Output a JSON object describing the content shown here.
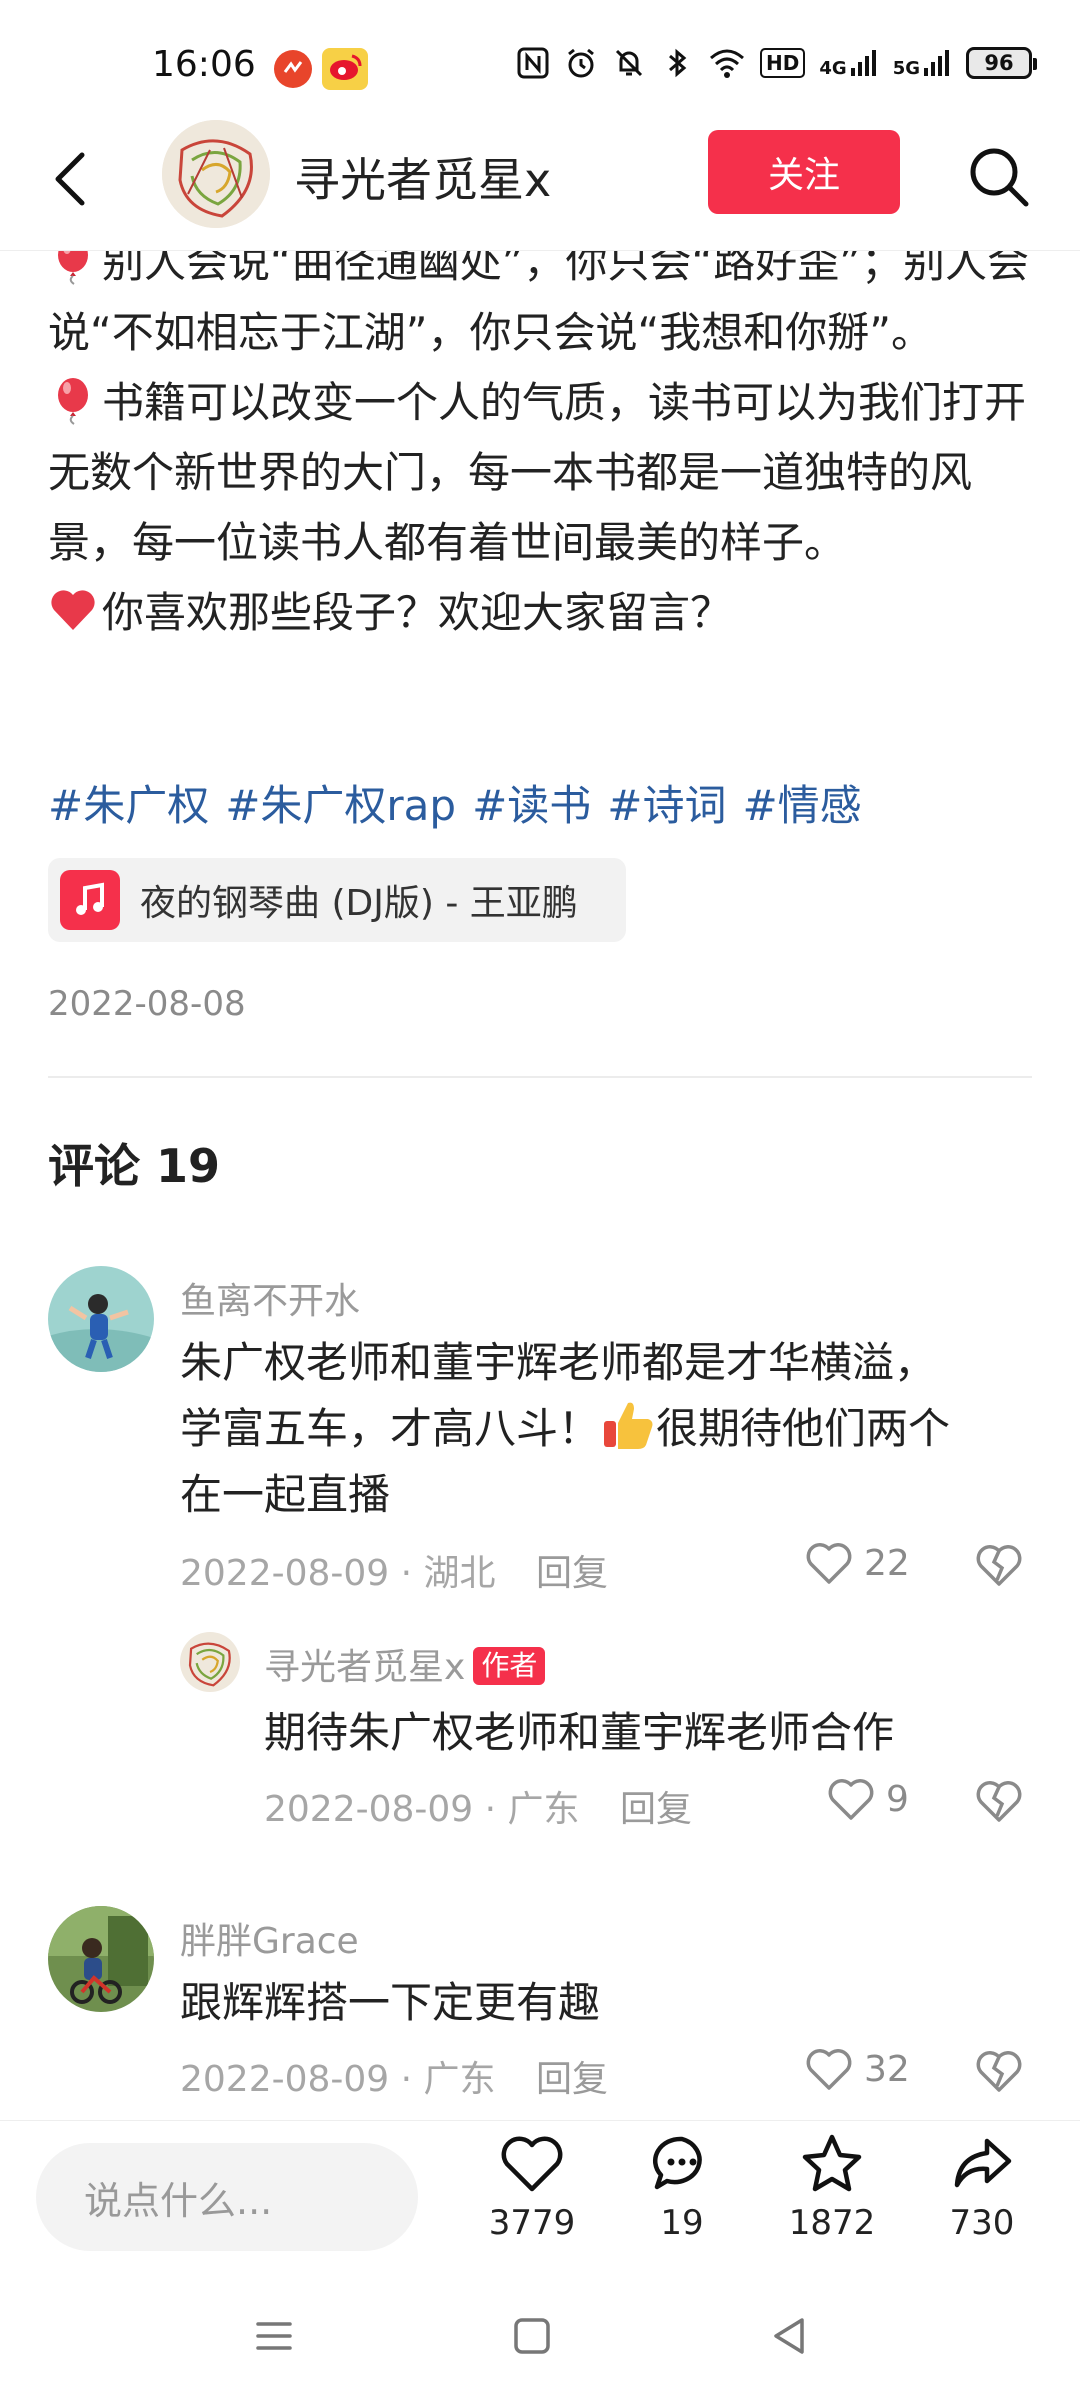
{
  "status_bar": {
    "time": "16:06",
    "battery": "96",
    "network_badge": "HD",
    "signal_1": "4G",
    "signal_2": "5G"
  },
  "header": {
    "author_name": "寻光者觅星x",
    "follow_label": "关注"
  },
  "post": {
    "paragraph_1": "别人会说“曲径通幽处”，你只会“路好歪”；别人会说“不如相忘于江湖”，你只会说“我想和你掰”。",
    "paragraph_2": "书籍可以改变一个人的气质，读书可以为我们打开无数个新世界的大门，每一本书都是一道独特的风景，每一位读书人都有着世间最美的样子。",
    "paragraph_3": "你喜欢那些段子？欢迎大家留言？",
    "tags": [
      "#朱广权",
      "#朱广权rap",
      "#读书",
      "#诗词",
      "#情感"
    ],
    "music": "夜的钢琴曲 (DJ版) - 王亚鹏",
    "date": "2022-08-08"
  },
  "comments_section": {
    "heading": "评论 19",
    "comments": [
      {
        "user": "鱼离不开水",
        "text_line_1": "朱广权老师和董宇辉老师都是才华横溢，",
        "text_line_2a": "学富五车，才高八斗！",
        "text_line_2b": "很期待他们两个",
        "text_line_3": "在一起直播",
        "meta": "2022-08-09 · 湖北",
        "reply_label": "回复",
        "likes": "22"
      },
      {
        "user": "寻光者觅星x",
        "author_tag": "作者",
        "text": "期待朱广权老师和董宇辉老师合作",
        "meta": "2022-08-09 · 广东",
        "reply_label": "回复",
        "likes": "9"
      },
      {
        "user": "胖胖Grace",
        "text": "跟辉辉搭一下定更有趣",
        "meta": "2022-08-09 · 广东",
        "reply_label": "回复",
        "likes": "32"
      }
    ]
  },
  "bottom_bar": {
    "input_placeholder": "说点什么...",
    "likes": "3779",
    "comments": "19",
    "favorites": "1872",
    "shares": "730"
  },
  "colors": {
    "accent": "#f5304b",
    "tag_blue": "#2b5c9e"
  }
}
